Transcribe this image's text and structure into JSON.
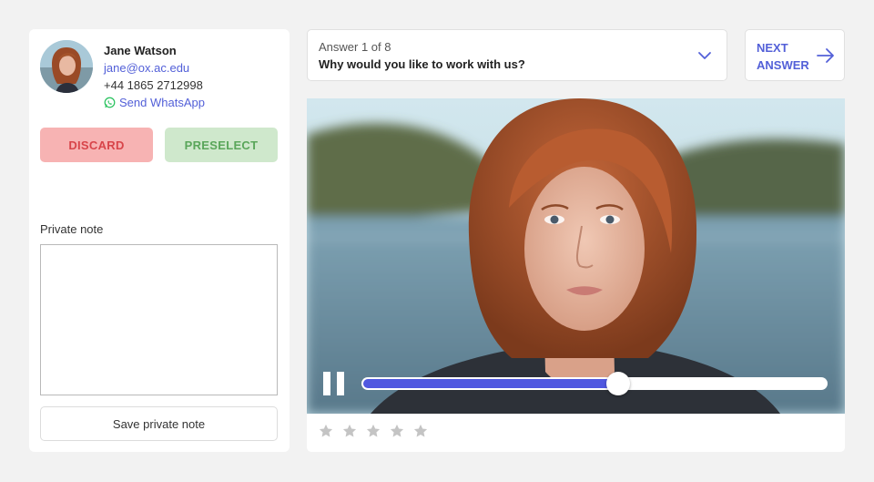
{
  "candidate": {
    "name": "Jane Watson",
    "email": "jane@ox.ac.edu",
    "phone": "+44 1865 2712998",
    "whatsapp_label": "Send WhatsApp"
  },
  "actions": {
    "discard_label": "DISCARD",
    "preselect_label": "PRESELECT"
  },
  "note": {
    "label": "Private note",
    "value": "",
    "placeholder": "",
    "save_label": "Save private note"
  },
  "answer": {
    "count_label": "Answer 1 of 8",
    "question": "Why would you like to work with us?",
    "next_label": "NEXT ANSWER"
  },
  "player": {
    "progress": 0.55,
    "state": "playing"
  },
  "rating": {
    "max": 5,
    "value": 0
  },
  "icons": {
    "whatsapp": "whatsapp-icon",
    "dropdown": "chevron-down-icon",
    "next": "arrow-right-icon",
    "pause": "pause-icon",
    "star": "star-icon"
  },
  "colors": {
    "accent": "#5360d8",
    "discard_bg": "#f7b3b3",
    "discard_text": "#d8454a",
    "preselect_bg": "#cfe8cc",
    "preselect_text": "#5aa65a",
    "seek_fill": "#5058e0",
    "star_empty": "#c4c4c4",
    "whatsapp": "#25c15b"
  }
}
